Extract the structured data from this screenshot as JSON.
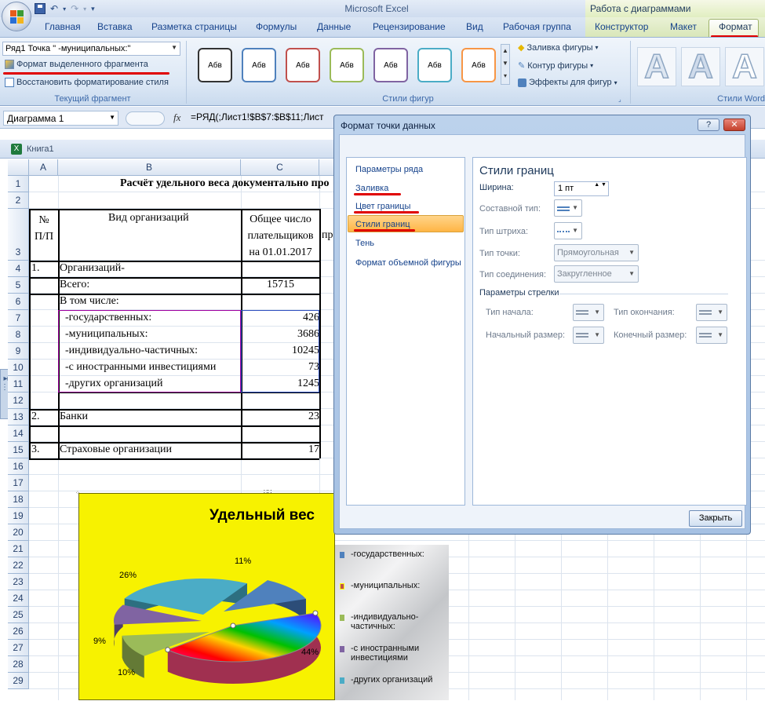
{
  "app": {
    "title": "Microsoft Excel",
    "context_header": "Работа с диаграммами"
  },
  "qat": {
    "save_icon": "save-icon",
    "undo_icon": "undo-icon",
    "redo_icon": "redo-icon",
    "customize_icon": "chevron-down-icon"
  },
  "tabs": [
    "Главная",
    "Вставка",
    "Разметка страницы",
    "Формулы",
    "Данные",
    "Рецензирование",
    "Вид",
    "Рабочая группа",
    "Конструктор",
    "Макет",
    "Формат"
  ],
  "ribbon": {
    "current_selection": {
      "combo_value": "Ряд1 Точка \"  -муниципальных:\"",
      "format_selection": "Формат выделенного фрагмента",
      "reset_style": "Восстановить форматирование стиля",
      "group_label": "Текущий фрагмент"
    },
    "shape_styles": {
      "label": "Абв",
      "group_label": "Стили фигур",
      "fill": "Заливка фигуры",
      "outline": "Контур фигуры",
      "effects": "Эффекты для фигур",
      "colors": [
        "#333333",
        "#4f81bd",
        "#c0504d",
        "#9bbb59",
        "#8064a2",
        "#4bacc6",
        "#f79646"
      ]
    },
    "wordart": {
      "group_label": "Стили Word",
      "letter": "A"
    }
  },
  "formula_bar": {
    "name_box": "Диаграмма 1",
    "fx": "fx",
    "formula": "=РЯД(;Лист1!$B$7:$B$11;Лист"
  },
  "workbook": {
    "title": "Книга1"
  },
  "sheet": {
    "columns": [
      "A",
      "B",
      "C"
    ],
    "rows": [
      "1",
      "2",
      "3",
      "4",
      "5",
      "6",
      "7",
      "8",
      "9",
      "10",
      "11",
      "12",
      "13",
      "14",
      "15",
      "16",
      "17",
      "18",
      "19",
      "20",
      "21",
      "22",
      "23",
      "24",
      "25",
      "26",
      "27",
      "28",
      "29"
    ],
    "title": "Расчёт удельного веса документально про",
    "header": {
      "num": "№\nП/П",
      "org": "Вид организаций",
      "total": "Общее число\nплательщиков\nна 01.01.2017",
      "partial": "пр"
    },
    "cells": [
      {
        "row": 4,
        "a": "1.",
        "b": "Организаций-",
        "c": ""
      },
      {
        "row": 5,
        "a": "",
        "b": "Всего:",
        "c": "15715"
      },
      {
        "row": 6,
        "a": "",
        "b": "В том числе:",
        "c": ""
      },
      {
        "row": 7,
        "a": "",
        "b": "  -государственных:",
        "c": "426"
      },
      {
        "row": 8,
        "a": "",
        "b": "  -муниципальных:",
        "c": "3686"
      },
      {
        "row": 9,
        "a": "",
        "b": "  -индивидуально-частичных:",
        "c": "10245"
      },
      {
        "row": 10,
        "a": "",
        "b": "  -с иностранными инвестициями",
        "c": "73"
      },
      {
        "row": 11,
        "a": "",
        "b": "  -других организаций",
        "c": "1245"
      },
      {
        "row": 13,
        "a": "2.",
        "b": "Банки",
        "c": "23"
      },
      {
        "row": 15,
        "a": "3.",
        "b": "Страховые организации",
        "c": "17"
      }
    ]
  },
  "chart": {
    "title": "Удельный вес",
    "labels": [
      "11%",
      "44%",
      "10%",
      "9%",
      "26%"
    ],
    "legend": [
      "-государственных:",
      "-муниципальных:",
      "-индивидуально-\nчастичных:",
      "-с иностранными\nинвестициями",
      "-других организаций"
    ],
    "legend_colors": [
      "#4f81bd",
      "#c0504d",
      "#9bbb59",
      "#8064a2",
      "#4bacc6"
    ]
  },
  "chart_data": {
    "type": "pie",
    "title": "Удельный вес",
    "categories": [
      "-государственных:",
      "-муниципальных:",
      "-индивидуально-частичных:",
      "-с иностранными инвестициями",
      "-других организаций"
    ],
    "values": [
      11,
      44,
      10,
      9,
      26
    ]
  },
  "dialog": {
    "title": "Формат точки данных",
    "help": "?",
    "close_x": "✕",
    "nav": [
      "Параметры ряда",
      "Заливка",
      "Цвет границы",
      "Стили границ",
      "Тень",
      "Формат объемной фигуры"
    ],
    "panel": {
      "heading": "Стили границ",
      "width_label": "Ширина:",
      "width_value": "1 пт",
      "compound_label": "Составной тип:",
      "dash_label": "Тип штриха:",
      "cap_label": "Тип точки:",
      "cap_value": "Прямоугольная",
      "join_label": "Тип соединения:",
      "join_value": "Закругленное",
      "arrow_section": "Параметры стрелки",
      "begin_type": "Тип начала:",
      "end_type": "Тип окончания:",
      "begin_size": "Начальный размер:",
      "end_size": "Конечный размер:"
    },
    "close_button": "Закрыть"
  }
}
